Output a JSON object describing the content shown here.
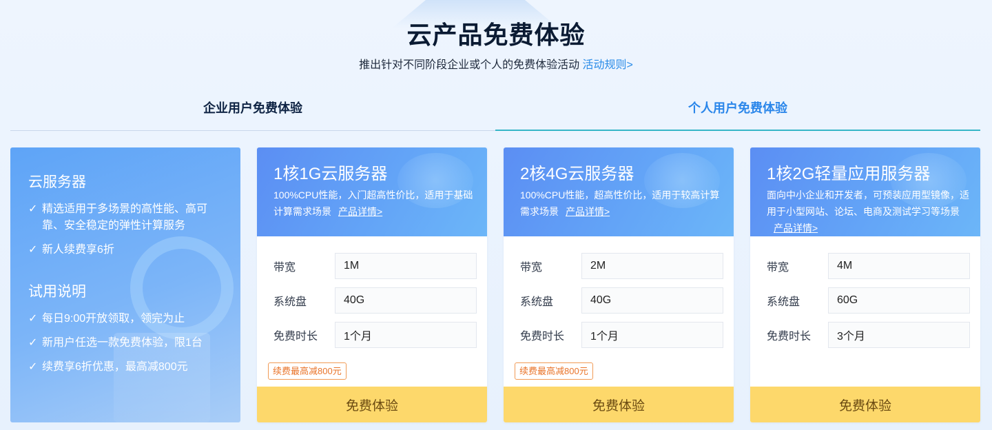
{
  "header": {
    "title": "云产品免费体验",
    "subtitle": "推出针对不同阶段企业或个人的免费体验活动",
    "rules_link": "活动规则>"
  },
  "tabs": [
    {
      "label": "企业用户免费体验",
      "active": false
    },
    {
      "label": "个人用户免费体验",
      "active": true
    }
  ],
  "info_card": {
    "section1_title": "云服务器",
    "section1_items": [
      "精选适用于多场景的高性能、高可靠、安全稳定的弹性计算服务",
      "新人续费享6折"
    ],
    "section2_title": "试用说明",
    "section2_items": [
      "每日9:00开放领取，领完为止",
      "新用户任选一款免费体验，限1台",
      "续费享6折优惠，最高减800元"
    ],
    "check_glyph": "✓"
  },
  "labels": {
    "bandwidth": "带宽",
    "disk": "系统盘",
    "duration": "免费时长",
    "detail_link": "产品详情>",
    "cta": "免费体验"
  },
  "products": [
    {
      "name": "1核1G云服务器",
      "desc": "100%CPU性能，入门超高性价比，适用于基础计算需求场景",
      "bandwidth": "1M",
      "disk": "40G",
      "duration": "1个月",
      "badge": "续费最高减800元"
    },
    {
      "name": "2核4G云服务器",
      "desc": "100%CPU性能，超高性价比，适用于较高计算需求场景",
      "bandwidth": "2M",
      "disk": "40G",
      "duration": "1个月",
      "badge": "续费最高减800元"
    },
    {
      "name": "1核2G轻量应用服务器",
      "desc": "面向中小企业和开发者，可预装应用型镜像，适用于小型网站、论坛、电商及测试学习等场景",
      "bandwidth": "4M",
      "disk": "60G",
      "duration": "3个月",
      "badge": ""
    }
  ],
  "colors": {
    "accent": "#2a86ea",
    "cta_bg": "#fdd86b",
    "badge": "#e9742a"
  }
}
